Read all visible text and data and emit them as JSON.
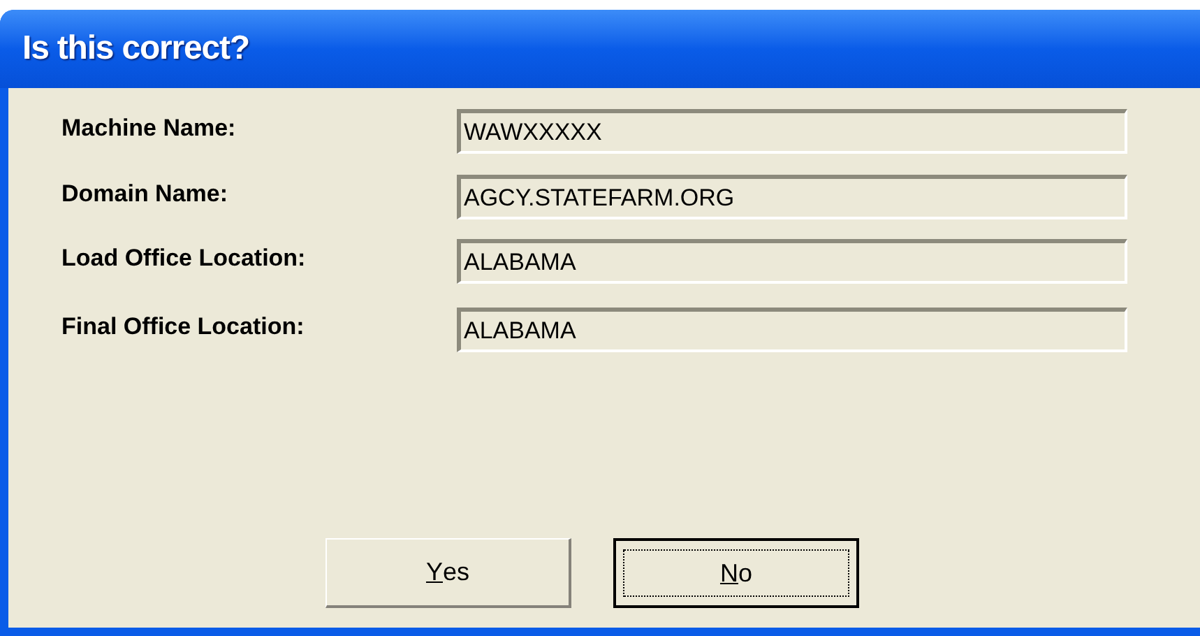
{
  "window": {
    "title": "Is this correct?"
  },
  "fields": [
    {
      "label": "Machine Name:",
      "value": "WAWXXXXX"
    },
    {
      "label": "Domain Name:",
      "value": "AGCY.STATEFARM.ORG"
    },
    {
      "label": "Load Office Location:",
      "value": "ALABAMA"
    },
    {
      "label": "Final Office Location:",
      "value": "ALABAMA"
    }
  ],
  "buttons": [
    {
      "label": "Yes",
      "mnemonic_underlined": true,
      "focused": false
    },
    {
      "label": "No",
      "mnemonic_underlined": true,
      "focused": true
    }
  ]
}
